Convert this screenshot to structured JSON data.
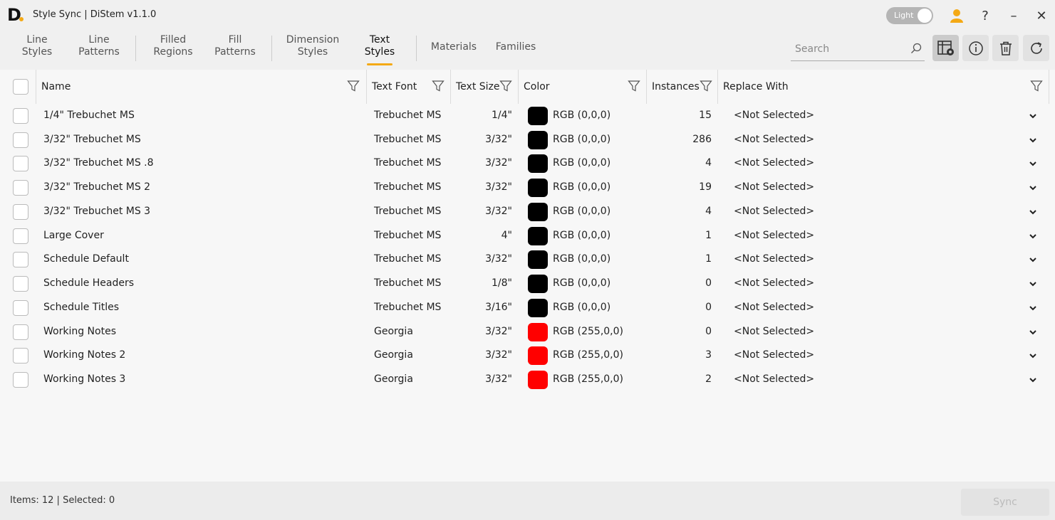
{
  "app": {
    "logo": "D",
    "title": "Style Sync | DiStem v1.1.0"
  },
  "theme_toggle": {
    "label": "Light"
  },
  "window_controls": {
    "help": "?",
    "minimize": "–",
    "close": "✕"
  },
  "tabs": [
    {
      "l1": "Line",
      "l2": "Styles"
    },
    {
      "l1": "Line",
      "l2": "Patterns"
    },
    {
      "l1": "Filled",
      "l2": "Regions"
    },
    {
      "l1": "Fill",
      "l2": "Patterns"
    },
    {
      "l1": "Dimension",
      "l2": "Styles"
    },
    {
      "l1": "Text",
      "l2": "Styles"
    },
    {
      "l1": "Materials",
      "l2": ""
    },
    {
      "l1": "Families",
      "l2": ""
    }
  ],
  "active_tab": "Text Styles",
  "search": {
    "placeholder": "Search"
  },
  "table": {
    "columns": [
      "Name",
      "Text Font",
      "Text Size",
      "Color",
      "Instances",
      "Replace With"
    ],
    "rows": [
      {
        "name": "1/4\" Trebuchet MS",
        "font": "Trebuchet MS",
        "size": "1/4\"",
        "color_hex": "#000000",
        "color": "RGB (0,0,0)",
        "instances": "15",
        "replace": "<Not Selected>"
      },
      {
        "name": "3/32\" Trebuchet MS",
        "font": "Trebuchet MS",
        "size": "3/32\"",
        "color_hex": "#000000",
        "color": "RGB (0,0,0)",
        "instances": "286",
        "replace": "<Not Selected>"
      },
      {
        "name": "3/32\" Trebuchet MS .8",
        "font": "Trebuchet MS",
        "size": "3/32\"",
        "color_hex": "#000000",
        "color": "RGB (0,0,0)",
        "instances": "4",
        "replace": "<Not Selected>"
      },
      {
        "name": "3/32\" Trebuchet MS 2",
        "font": "Trebuchet MS",
        "size": "3/32\"",
        "color_hex": "#000000",
        "color": "RGB (0,0,0)",
        "instances": "19",
        "replace": "<Not Selected>"
      },
      {
        "name": "3/32\" Trebuchet MS 3",
        "font": "Trebuchet MS",
        "size": "3/32\"",
        "color_hex": "#000000",
        "color": "RGB (0,0,0)",
        "instances": "4",
        "replace": "<Not Selected>"
      },
      {
        "name": "Large Cover",
        "font": "Trebuchet MS",
        "size": "4\"",
        "color_hex": "#000000",
        "color": "RGB (0,0,0)",
        "instances": "1",
        "replace": "<Not Selected>"
      },
      {
        "name": "Schedule Default",
        "font": "Trebuchet MS",
        "size": "3/32\"",
        "color_hex": "#000000",
        "color": "RGB (0,0,0)",
        "instances": "1",
        "replace": "<Not Selected>"
      },
      {
        "name": "Schedule Headers",
        "font": "Trebuchet MS",
        "size": "1/8\"",
        "color_hex": "#000000",
        "color": "RGB (0,0,0)",
        "instances": "0",
        "replace": "<Not Selected>"
      },
      {
        "name": "Schedule Titles",
        "font": "Trebuchet MS",
        "size": "3/16\"",
        "color_hex": "#000000",
        "color": "RGB (0,0,0)",
        "instances": "0",
        "replace": "<Not Selected>"
      },
      {
        "name": "Working Notes",
        "font": "Georgia",
        "size": "3/32\"",
        "color_hex": "#ff0000",
        "color": "RGB (255,0,0)",
        "instances": "0",
        "replace": "<Not Selected>"
      },
      {
        "name": "Working Notes 2",
        "font": "Georgia",
        "size": "3/32\"",
        "color_hex": "#ff0000",
        "color": "RGB (255,0,0)",
        "instances": "3",
        "replace": "<Not Selected>"
      },
      {
        "name": "Working Notes 3",
        "font": "Georgia",
        "size": "3/32\"",
        "color_hex": "#ff0000",
        "color": "RGB (255,0,0)",
        "instances": "2",
        "replace": "<Not Selected>"
      }
    ]
  },
  "footer": {
    "status": "Items: 12 | Selected: 0",
    "sync_label": "Sync"
  },
  "colors": {
    "accent": "#f4a915"
  }
}
